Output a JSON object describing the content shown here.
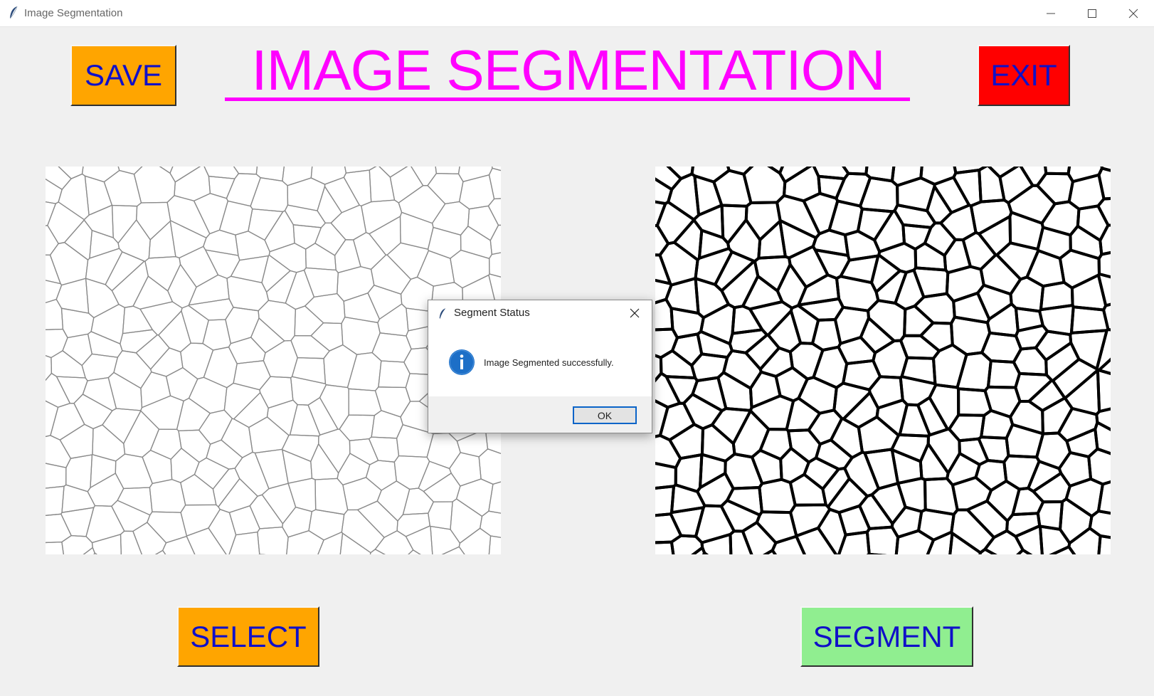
{
  "window": {
    "title": "Image Segmentation"
  },
  "header": {
    "title": "IMAGE SEGMENTATION",
    "title_color": "#ff00ff",
    "save_label": "SAVE",
    "exit_label": "EXIT"
  },
  "panels": {
    "original": {
      "description": ""
    },
    "segmented": {
      "description": ""
    }
  },
  "actions": {
    "select_label": "SELECT",
    "segment_label": "SEGMENT"
  },
  "dialog": {
    "title": "Segment Status",
    "message": "Image Segmented successfully.",
    "ok_label": "OK",
    "icon": "info-icon"
  },
  "colors": {
    "save_bg": "#ffa500",
    "exit_bg": "#ff0000",
    "select_bg": "#ffa500",
    "segment_bg": "#90ee90",
    "button_text": "#1010c8"
  }
}
